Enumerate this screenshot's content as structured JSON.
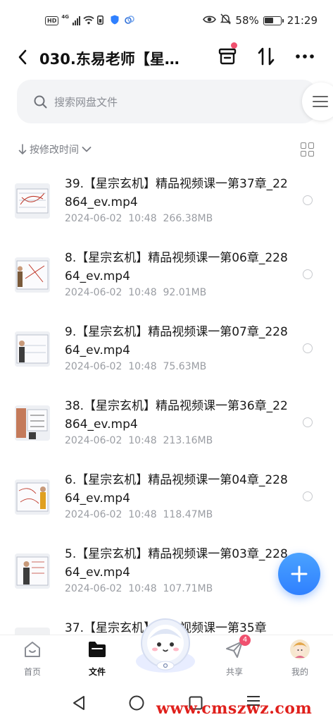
{
  "status_bar": {
    "hd": "HD",
    "network": "4G",
    "battery_pct": "58%",
    "time": "21:29",
    "battery_level": 0.58
  },
  "header": {
    "title": "030.东易老师【星…",
    "back_icon": "chevron-left-icon",
    "actions": [
      "archive-box-icon",
      "sort-arrows-icon",
      "more-dots-icon"
    ]
  },
  "search": {
    "placeholder": "搜索网盘文件",
    "icon": "search-icon"
  },
  "sort": {
    "label": "按修改时间"
  },
  "files": [
    {
      "name": "39.【星宗玄机】精品视频课一第37章_22864_ev.mp4",
      "date": "2024-06-02  10:48",
      "size": "266.38MB"
    },
    {
      "name": "8.【星宗玄机】精品视频课一第06章_22864_ev.mp4",
      "date": "2024-06-02  10:48",
      "size": "92.01MB"
    },
    {
      "name": "9.【星宗玄机】精品视频课一第07章_22864_ev.mp4",
      "date": "2024-06-02  10:48",
      "size": "75.63MB"
    },
    {
      "name": "38.【星宗玄机】精品视频课一第36章_22864_ev.mp4",
      "date": "2024-06-02  10:48",
      "size": "213.16MB"
    },
    {
      "name": "6.【星宗玄机】精品视频课一第04章_22864_ev.mp4",
      "date": "2024-06-02  10:48",
      "size": "118.47MB"
    },
    {
      "name": "5.【星宗玄机】精品视频课一第03章_22864_ev.mp4",
      "date": "2024-06-02  10:48",
      "size": "107.71MB"
    },
    {
      "name": "37.【星宗玄机】精品视频课一第35章",
      "date": "",
      "size": ""
    }
  ],
  "fab": {
    "icon": "plus-icon"
  },
  "nav": {
    "items": [
      {
        "label": "首页",
        "icon": "home-icon"
      },
      {
        "label": "文件",
        "icon": "folder-icon"
      },
      {
        "label": "共享",
        "icon": "send-icon",
        "badge": "4"
      },
      {
        "label": "我的",
        "icon": "avatar-icon"
      }
    ]
  },
  "watermark": "www.cmszwz.com",
  "colors": {
    "accent": "#2f80ff",
    "badge": "#f0506e",
    "watermark": "#e0201c"
  }
}
